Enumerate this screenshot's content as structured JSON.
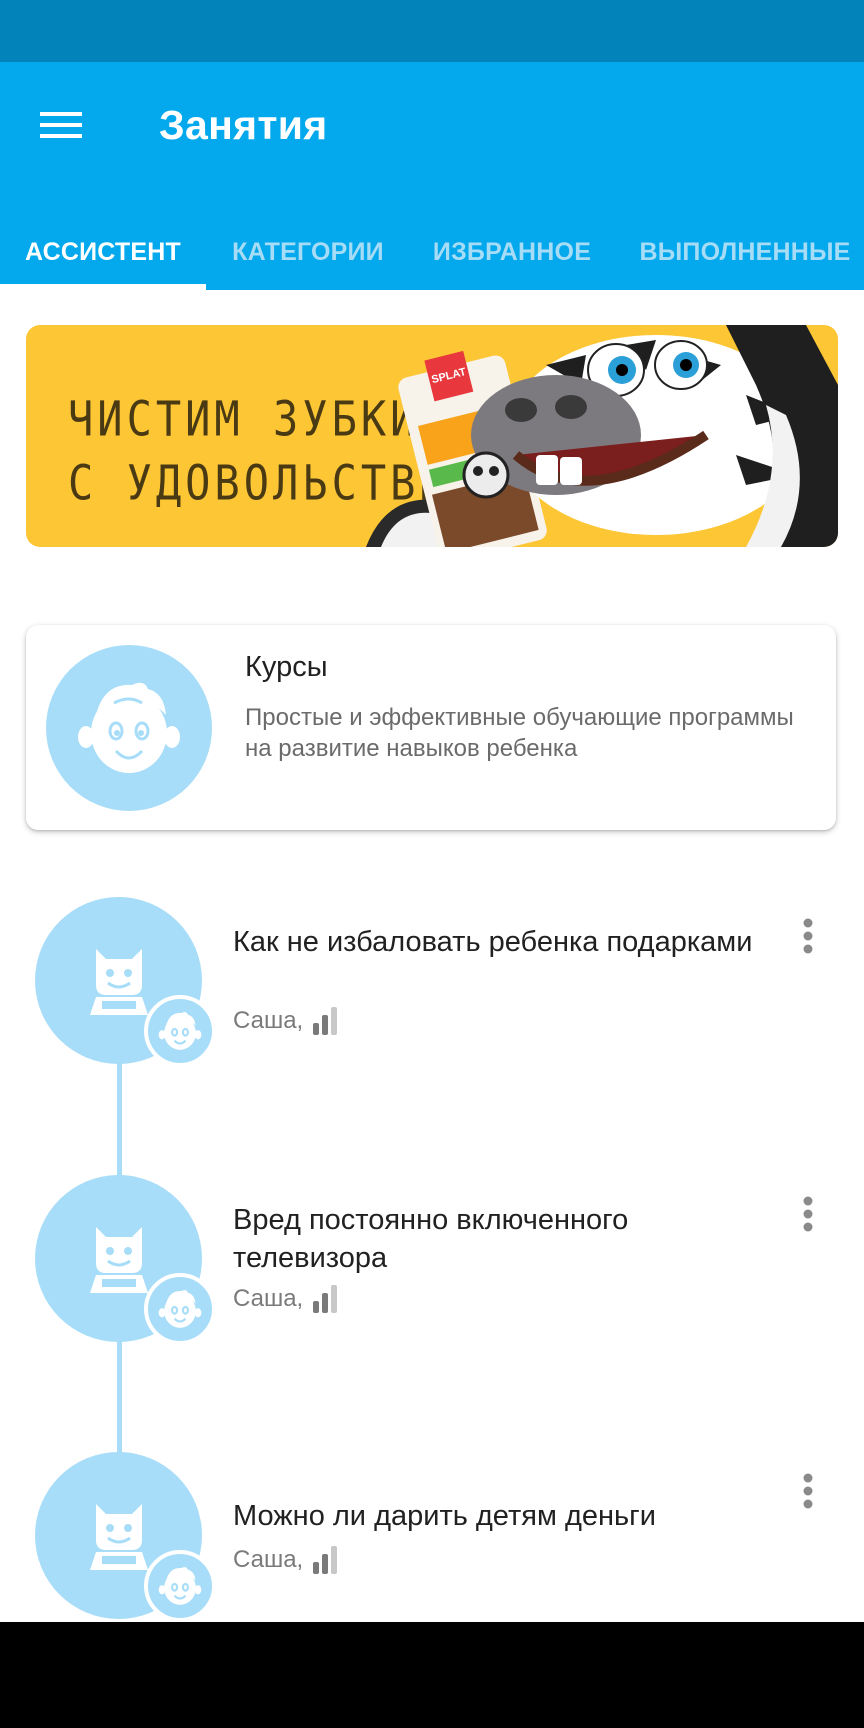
{
  "app_bar": {
    "title": "Занятия",
    "menu_icon": "hamburger-menu-icon"
  },
  "tabs": [
    {
      "label": "АССИСТЕНТ",
      "active": true
    },
    {
      "label": "КАТЕГОРИИ",
      "active": false
    },
    {
      "label": "ИЗБРАННОЕ",
      "active": false
    },
    {
      "label": "ВЫПОЛНЕННЫЕ",
      "active": false
    }
  ],
  "banner": {
    "line1": "ЧИСТИМ ЗУБКИ",
    "line2": "С УДОВОЛЬСТВИЕМ",
    "product_brand": "SPLAT",
    "background_color": "#fdc635"
  },
  "courses": {
    "title": "Курсы",
    "description": "Простые и эффективные обучающие программы на развитие навыков ребенка",
    "icon": "child-face-icon"
  },
  "lessons": [
    {
      "title": "Как не избаловать ребенка подарками",
      "meta": "Саша,",
      "icon": "assistant-robot-icon",
      "badge_icon": "child-face-icon",
      "level_icon": "difficulty-bars-icon"
    },
    {
      "title": "Вред постоянно включенного телевизора",
      "meta": "Саша,",
      "icon": "assistant-robot-icon",
      "badge_icon": "child-face-icon",
      "level_icon": "difficulty-bars-icon"
    },
    {
      "title": "Можно ли дарить детям деньги",
      "meta": "Саша,",
      "icon": "assistant-robot-icon",
      "badge_icon": "child-face-icon",
      "level_icon": "difficulty-bars-icon"
    }
  ],
  "colors": {
    "status_bar": "#0283b9",
    "primary": "#03a9ec",
    "avatar_bg": "#a7ddf8",
    "inactive_tab": "#a7dcf6"
  }
}
